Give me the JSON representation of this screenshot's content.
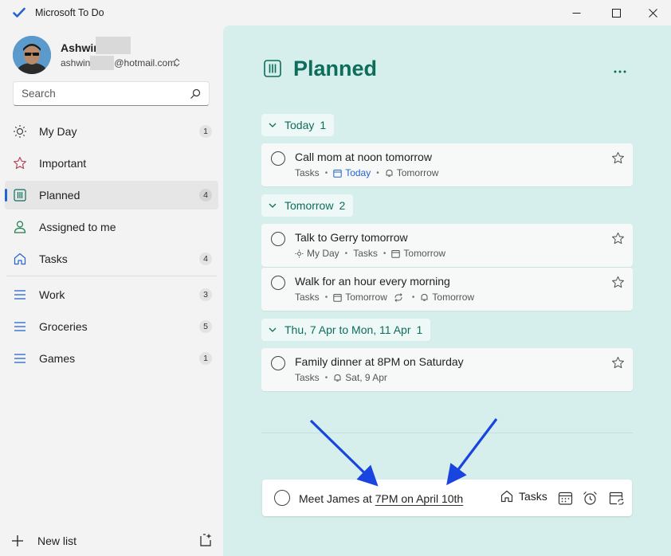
{
  "window": {
    "title": "Microsoft To Do"
  },
  "user": {
    "name": "Ashwin",
    "email_prefix": "ashwin",
    "email_suffix": "@hotmail.com"
  },
  "search": {
    "placeholder": "Search"
  },
  "sidebar": {
    "items": [
      {
        "label": "My Day",
        "count": "1",
        "icon": "sun-icon"
      },
      {
        "label": "Important",
        "count": "",
        "icon": "star-icon"
      },
      {
        "label": "Planned",
        "count": "4",
        "icon": "calendar-grid-icon"
      },
      {
        "label": "Assigned to me",
        "count": "",
        "icon": "person-icon"
      },
      {
        "label": "Tasks",
        "count": "4",
        "icon": "home-icon"
      }
    ],
    "lists": [
      {
        "label": "Work",
        "count": "3",
        "icon": "list-icon"
      },
      {
        "label": "Groceries",
        "count": "5",
        "icon": "list-icon"
      },
      {
        "label": "Games",
        "count": "1",
        "icon": "list-icon"
      }
    ],
    "new_list_label": "New list"
  },
  "main": {
    "title": "Planned",
    "groups": [
      {
        "label": "Today",
        "count": "1"
      },
      {
        "label": "Tomorrow",
        "count": "2"
      },
      {
        "label": "Thu, 7 Apr to Mon, 11 Apr",
        "count": "1"
      }
    ],
    "tasks": [
      {
        "title": "Call mom at noon tomorrow",
        "list": "Tasks",
        "due": "Today",
        "reminder": "Tomorrow"
      },
      {
        "title": "Talk to Gerry tomorrow",
        "myday": "My Day",
        "list": "Tasks",
        "reminder": "Tomorrow"
      },
      {
        "title": "Walk for an hour every morning",
        "list": "Tasks",
        "due": "Tomorrow",
        "reminder": "Tomorrow"
      },
      {
        "title": "Family dinner at 8PM on Saturday",
        "list": "Tasks",
        "reminder": "Sat, 9 Apr"
      }
    ],
    "add_task": {
      "text_plain": "Meet James at ",
      "text_highlight": "7PM on April 10th",
      "list_label": "Tasks"
    }
  },
  "colors": {
    "accent": "#2564cf",
    "planned_green": "#0c6d5b",
    "main_bg": "#d6efec",
    "arrow_blue": "#1a44e0"
  }
}
